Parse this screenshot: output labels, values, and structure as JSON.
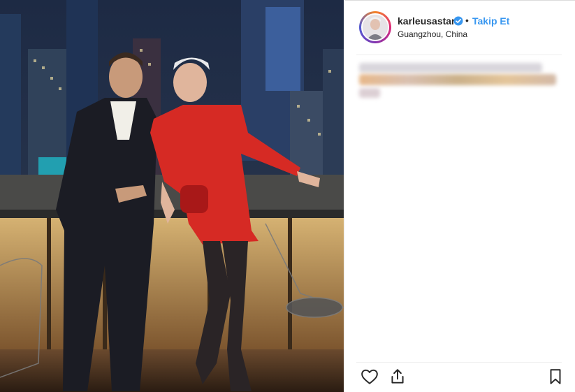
{
  "post": {
    "photo_alt": "",
    "username": "karleusastar",
    "dot": "•",
    "follow_label": "Takip Et",
    "location": "Guangzhou, China",
    "verified": true
  },
  "icons": {
    "verified": "verified-badge-icon",
    "like": "heart-icon",
    "share": "share-icon",
    "save": "bookmark-icon"
  },
  "colors": {
    "link_blue": "#3897f0",
    "text": "#262626",
    "divider": "#efefef"
  }
}
